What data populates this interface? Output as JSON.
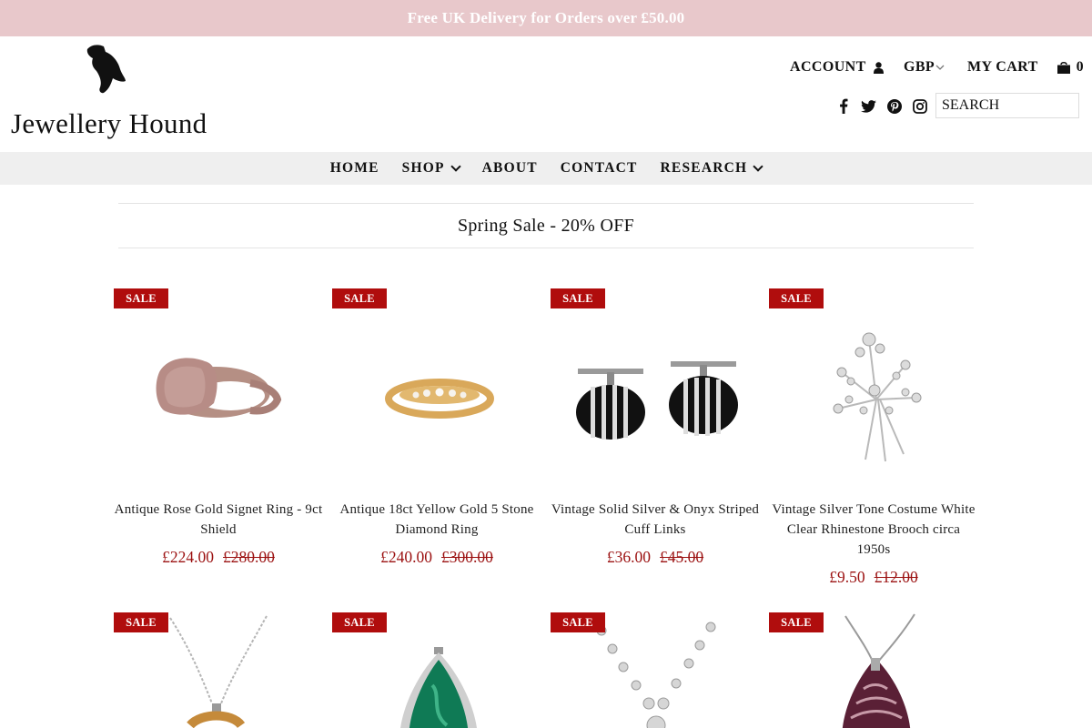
{
  "promo": {
    "text": "Free UK Delivery for Orders over £50.00"
  },
  "brand": {
    "name": "Jewellery Hound"
  },
  "header": {
    "account_label": "ACCOUNT",
    "currency": "GBP",
    "cart_label": "MY CART",
    "cart_count": "0",
    "search_placeholder": "SEARCH",
    "social_icons": [
      "facebook-icon",
      "twitter-icon",
      "pinterest-icon",
      "instagram-icon"
    ]
  },
  "nav": {
    "items": [
      {
        "label": "HOME",
        "has_dropdown": false
      },
      {
        "label": "SHOP",
        "has_dropdown": true
      },
      {
        "label": "ABOUT",
        "has_dropdown": false
      },
      {
        "label": "CONTACT",
        "has_dropdown": false
      },
      {
        "label": "RESEARCH",
        "has_dropdown": true
      }
    ]
  },
  "collection": {
    "title": "Spring Sale - 20% OFF"
  },
  "colors": {
    "promo_bg": "#e8c8cb",
    "sale_red": "#b00d0d",
    "price_red": "#9b1010",
    "nav_bg": "#efefef"
  },
  "products": [
    {
      "badge": "SALE",
      "title": "Antique Rose Gold Signet Ring - 9ct Shield",
      "price": "£224.00",
      "compare_price": "£280.00",
      "image": "rose-gold-signet-ring"
    },
    {
      "badge": "SALE",
      "title": "Antique 18ct Yellow Gold 5 Stone Diamond Ring",
      "price": "£240.00",
      "compare_price": "£300.00",
      "image": "yellow-gold-diamond-ring"
    },
    {
      "badge": "SALE",
      "title": "Vintage Solid Silver & Onyx Striped Cuff Links",
      "price": "£36.00",
      "compare_price": "£45.00",
      "image": "silver-onyx-cufflinks"
    },
    {
      "badge": "SALE",
      "title": "Vintage Silver Tone Costume White Clear Rhinestone Brooch circa 1950s",
      "price": "£9.50",
      "compare_price": "£12.00",
      "image": "rhinestone-brooch"
    },
    {
      "badge": "SALE",
      "image": "amber-pendant-necklace"
    },
    {
      "badge": "SALE",
      "image": "malachite-pendant"
    },
    {
      "badge": "SALE",
      "image": "silver-filigree-necklace"
    },
    {
      "badge": "SALE",
      "image": "agate-pendant-necklace"
    }
  ]
}
